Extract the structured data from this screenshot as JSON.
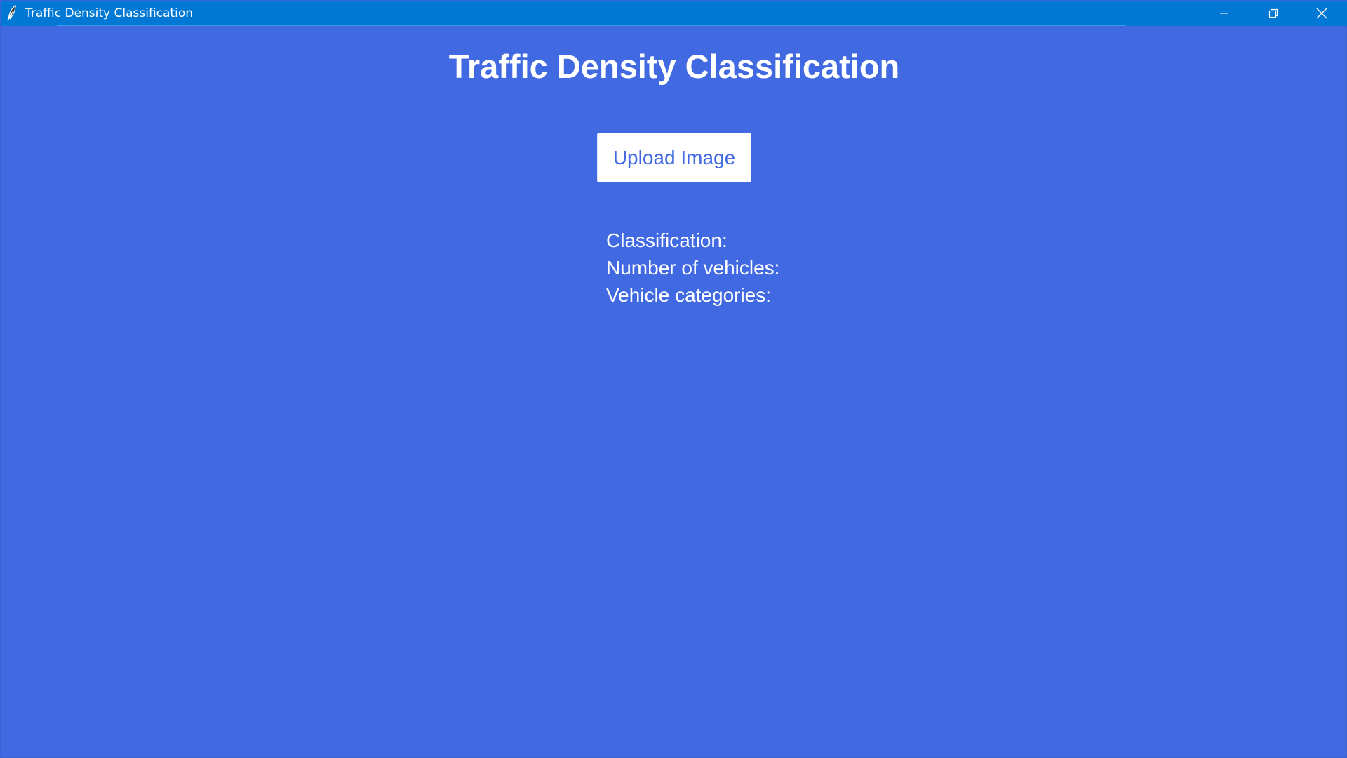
{
  "window": {
    "title": "Traffic Density Classification",
    "app_icon": "feather-icon",
    "controls": {
      "minimize_icon": "minimize-icon",
      "maximize_icon": "restore-icon",
      "close_icon": "close-icon"
    }
  },
  "main": {
    "heading": "Traffic Density Classification",
    "upload_button_label": "Upload Image",
    "results": {
      "classification_label": "Classification:",
      "vehicle_count_label": "Number of vehicles:",
      "vehicle_categories_label": "Vehicle categories:"
    }
  },
  "colors": {
    "background": "#4169E1",
    "titlebar": "#0078D4",
    "text": "#FFFFFF",
    "button_background": "#FFFFFF",
    "button_text": "#4169E1"
  }
}
